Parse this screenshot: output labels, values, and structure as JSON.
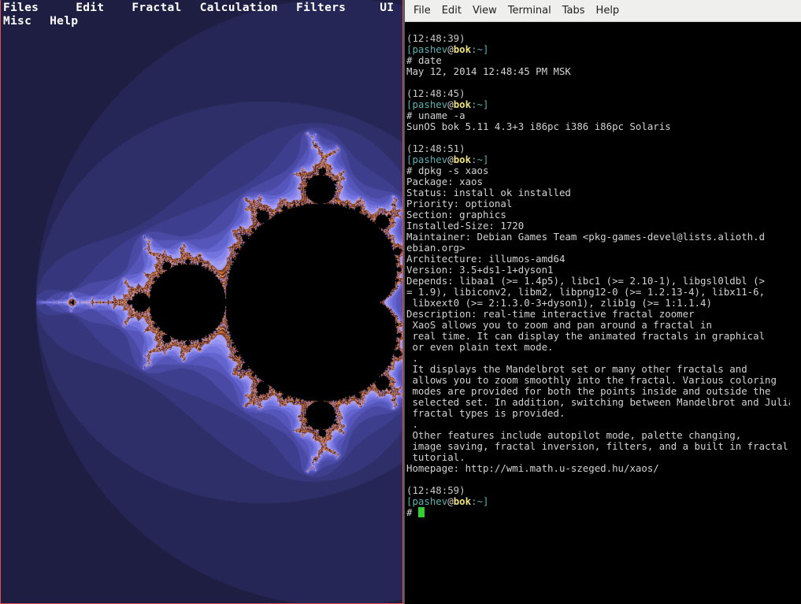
{
  "xaos": {
    "menu_row1": [
      "Files",
      "Edit",
      "Fractal",
      "Calculation",
      "Filters",
      "UI"
    ],
    "menu_row2": [
      "Misc",
      "Help"
    ]
  },
  "terminal": {
    "menu": [
      "File",
      "Edit",
      "View",
      "Terminal",
      "Tabs",
      "Help"
    ],
    "prompt": {
      "user": "pashev",
      "host": "bok",
      "path": "~",
      "symbol": "#"
    },
    "sessions": [
      {
        "time": "(12:48:39)",
        "command": "date",
        "output": [
          "May 12, 2014 12:48:45 PM MSK"
        ]
      },
      {
        "time": "(12:48:45)",
        "command": "uname -a",
        "output": [
          "SunOS bok 5.11 4.3+3 i86pc i386 i86pc Solaris"
        ]
      },
      {
        "time": "(12:48:51)",
        "command": "dpkg -s xaos",
        "output": [
          "Package: xaos",
          "Status: install ok installed",
          "Priority: optional",
          "Section: graphics",
          "Installed-Size: 1720",
          "Maintainer: Debian Games Team <pkg-games-devel@lists.alioth.d",
          "ebian.org>",
          "Architecture: illumos-amd64",
          "Version: 3.5+ds1-1+dyson1",
          "Depends: libaa1 (>= 1.4p5), libc1 (>= 2.10-1), libgsl0ldbl (>",
          "= 1.9), libiconv2, libm2, libpng12-0 (>= 1.2.13-4), libx11-6,",
          " libxext0 (>= 2:1.3.0-3+dyson1), zlib1g (>= 1:1.1.4)",
          "Description: real-time interactive fractal zoomer",
          " XaoS allows you to zoom and pan around a fractal in",
          " real time. It can display the animated fractals in graphical",
          " or even plain text mode.",
          " .",
          " It displays the Mandelbrot set or many other fractals and",
          " allows you to zoom smoothly into the fractal. Various coloring",
          " modes are provided for both the points inside and outside the",
          " selected set. In addition, switching between Mandelbrot and Julia",
          " fractal types is provided.",
          " .",
          " Other features include autopilot mode, palette changing,",
          " image saving, fractal inversion, filters, and a built in fractal",
          " tutorial.",
          "Homepage: http://wmi.math.u-szeged.hu/xaos/"
        ]
      },
      {
        "time": "(12:48:59)",
        "command": "",
        "output": []
      }
    ]
  }
}
